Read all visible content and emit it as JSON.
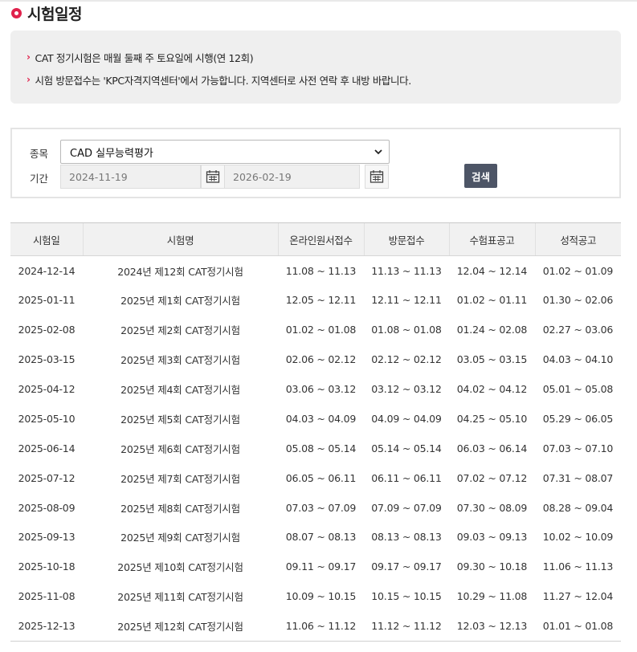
{
  "page": {
    "title": "시험일정"
  },
  "notices": [
    "CAT 정기시험은 매월 둘째 주 토요일에 시행(연 12회)",
    "시험 방문접수는 'KPC자격지역센터'에서 가능합니다. 지역센터로 사전 연락 후 내방 바랍니다."
  ],
  "search": {
    "type_label": "종목",
    "type_value": "CAD 실무능력평가",
    "period_label": "기간",
    "start_date": "2024-11-19",
    "end_date": "2026-02-19",
    "search_label": "검색"
  },
  "table": {
    "headers": [
      "시험일",
      "시험명",
      "온라인원서접수",
      "방문접수",
      "수험표공고",
      "성적공고"
    ],
    "rows": [
      [
        "2024-12-14",
        "2024년 제12회 CAT정기시험",
        "11.08 ~ 11.13",
        "11.13 ~ 11.13",
        "12.04 ~ 12.14",
        "01.02 ~ 01.09"
      ],
      [
        "2025-01-11",
        "2025년 제1회 CAT정기시험",
        "12.05 ~ 12.11",
        "12.11 ~ 12.11",
        "01.02 ~ 01.11",
        "01.30 ~ 02.06"
      ],
      [
        "2025-02-08",
        "2025년 제2회 CAT정기시험",
        "01.02 ~ 01.08",
        "01.08 ~ 01.08",
        "01.24 ~ 02.08",
        "02.27 ~ 03.06"
      ],
      [
        "2025-03-15",
        "2025년 제3회 CAT정기시험",
        "02.06 ~ 02.12",
        "02.12 ~ 02.12",
        "03.05 ~ 03.15",
        "04.03 ~ 04.10"
      ],
      [
        "2025-04-12",
        "2025년 제4회 CAT정기시험",
        "03.06 ~ 03.12",
        "03.12 ~ 03.12",
        "04.02 ~ 04.12",
        "05.01 ~ 05.08"
      ],
      [
        "2025-05-10",
        "2025년 제5회 CAT정기시험",
        "04.03 ~ 04.09",
        "04.09 ~ 04.09",
        "04.25 ~ 05.10",
        "05.29 ~ 06.05"
      ],
      [
        "2025-06-14",
        "2025년 제6회 CAT정기시험",
        "05.08 ~ 05.14",
        "05.14 ~ 05.14",
        "06.03 ~ 06.14",
        "07.03 ~ 07.10"
      ],
      [
        "2025-07-12",
        "2025년 제7회 CAT정기시험",
        "06.05 ~ 06.11",
        "06.11 ~ 06.11",
        "07.02 ~ 07.12",
        "07.31 ~ 08.07"
      ],
      [
        "2025-08-09",
        "2025년 제8회 CAT정기시험",
        "07.03 ~ 07.09",
        "07.09 ~ 07.09",
        "07.30 ~ 08.09",
        "08.28 ~ 09.04"
      ],
      [
        "2025-09-13",
        "2025년 제9회 CAT정기시험",
        "08.07 ~ 08.13",
        "08.13 ~ 08.13",
        "09.03 ~ 09.13",
        "10.02 ~ 10.09"
      ],
      [
        "2025-10-18",
        "2025년 제10회 CAT정기시험",
        "09.11 ~ 09.17",
        "09.17 ~ 09.17",
        "09.30 ~ 10.18",
        "11.06 ~ 11.13"
      ],
      [
        "2025-11-08",
        "2025년 제11회 CAT정기시험",
        "10.09 ~ 10.15",
        "10.15 ~ 10.15",
        "10.29 ~ 11.08",
        "11.27 ~ 12.04"
      ],
      [
        "2025-12-13",
        "2025년 제12회 CAT정기시험",
        "11.06 ~ 11.12",
        "11.12 ~ 11.12",
        "12.03 ~ 12.13",
        "01.01 ~ 01.08"
      ]
    ]
  },
  "icons": {
    "title": "circle-bullet-icon",
    "notice": "chevron-right-icon",
    "select": "chevron-down-icon",
    "date": "calendar-icon"
  },
  "colors": {
    "accent": "#e0224c",
    "search_button": "#4d5566",
    "notice_bg": "#efefef",
    "table_header_bg": "#f1f1f1"
  }
}
